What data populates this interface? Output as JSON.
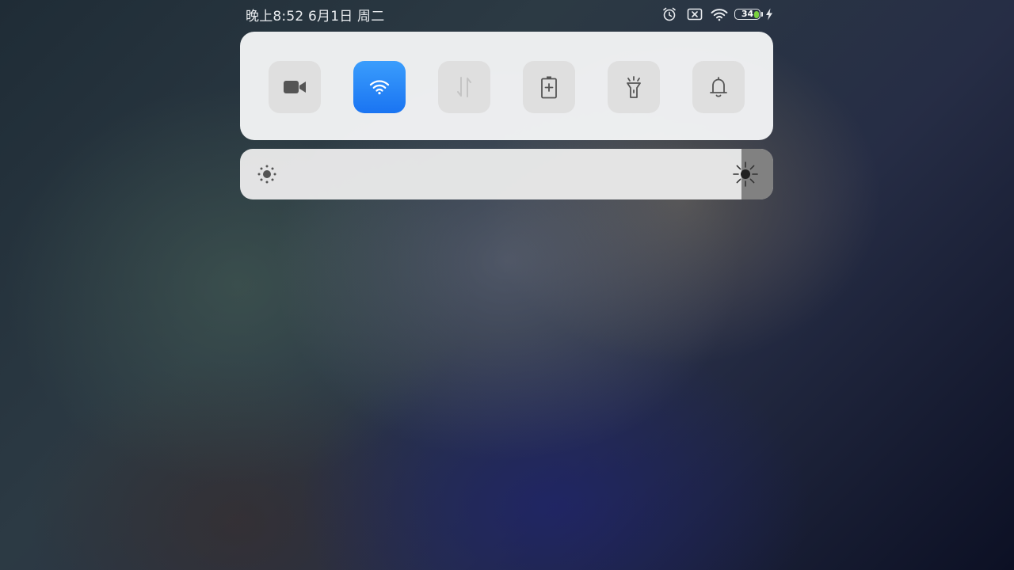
{
  "status_bar": {
    "clock": "晚上8:52 6月1日 周二",
    "icons": [
      "alarm-icon",
      "no-sim-icon",
      "wifi-icon",
      "battery-icon",
      "charging-bolt-icon"
    ],
    "battery": {
      "level_text": "34",
      "level_percent": 34,
      "fill_color": "#7ad13f"
    }
  },
  "quick_toggles": [
    {
      "id": "screen-recorder",
      "icon": "video-camera-icon",
      "active": false
    },
    {
      "id": "wifi",
      "icon": "wifi-icon",
      "active": true
    },
    {
      "id": "mobile-data",
      "icon": "data-transfer-icon",
      "active": false,
      "disabled": true
    },
    {
      "id": "battery-saver",
      "icon": "battery-saver-icon",
      "active": false
    },
    {
      "id": "flashlight",
      "icon": "flashlight-icon",
      "active": false
    },
    {
      "id": "sound",
      "icon": "bell-icon",
      "active": false
    }
  ],
  "brightness": {
    "level_percent": 94,
    "low_icon": "sun-low-icon",
    "high_icon": "sun-high-icon"
  },
  "colors": {
    "accent": "#1a74f2",
    "panel_background": "#f4f5f6",
    "toggle_inactive": "#dfdfdf",
    "icon_gray": "#555555"
  }
}
